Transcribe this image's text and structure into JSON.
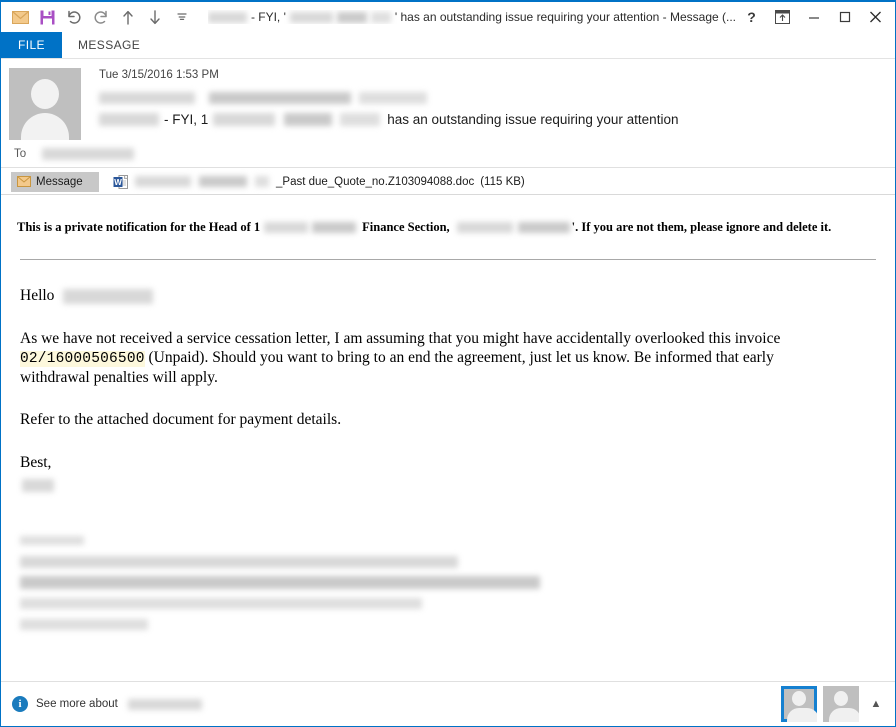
{
  "window": {
    "title_visible": "- FYI, ' has an outstanding issue requiring your attention - Message (...",
    "title_prefix_redacted": true,
    "title_mid_1": "- FYI, '",
    "title_mid_2": "' has an outstanding issue requiring your attention - Message (..."
  },
  "quick_access": {
    "items": [
      {
        "name": "mail-icon",
        "label": "Mail"
      },
      {
        "name": "save-icon",
        "label": "Save"
      },
      {
        "name": "undo-icon",
        "label": "Undo"
      },
      {
        "name": "redo-icon",
        "label": "Redo"
      },
      {
        "name": "previous-item-icon",
        "label": "Previous Item"
      },
      {
        "name": "next-item-icon",
        "label": "Next Item"
      },
      {
        "name": "customize-qat-icon",
        "label": "Customize Quick Access Toolbar"
      }
    ]
  },
  "window_controls": {
    "help": "?",
    "ribbon_options": "ribbon-display-options",
    "minimize": "—",
    "maximize": "□",
    "close": "×"
  },
  "ribbon": {
    "tabs": [
      {
        "label": "FILE",
        "active": true
      },
      {
        "label": "MESSAGE",
        "active": false
      }
    ],
    "accent_color": "#0072C6"
  },
  "header": {
    "date": "Tue 3/15/2016 1:53 PM",
    "subject_part_1": "- FYI, 1",
    "subject_part_2": "has an outstanding issue requiring your attention",
    "to_label": "To"
  },
  "attachments": {
    "message_tab_label": "Message",
    "file_suffix": "_Past due_Quote_no.Z103094088.doc",
    "file_size": "(115 KB)"
  },
  "body": {
    "notice_part_1": "This is a private notification for the Head of 1",
    "notice_part_2": "Finance Section,",
    "notice_part_3": "'. If you are not them, please ignore and delete it.",
    "greeting": "Hello",
    "paragraph_1_a": "As we have not received a service cessation letter, I am assuming that you might have accidentally overlooked this invoice",
    "invoice_number": "02/16000506500",
    "paragraph_1_b": "(Unpaid). Should you want to bring to an end the agreement, just let us know. Be informed that early withdrawal penalties will apply.",
    "paragraph_2": "Refer to the attached document for payment details.",
    "signoff": "Best,",
    "highlight_color": "#FDF8DC"
  },
  "status": {
    "see_more_label": "See more about",
    "info_glyph": "i",
    "collapse_glyph": "▲"
  }
}
